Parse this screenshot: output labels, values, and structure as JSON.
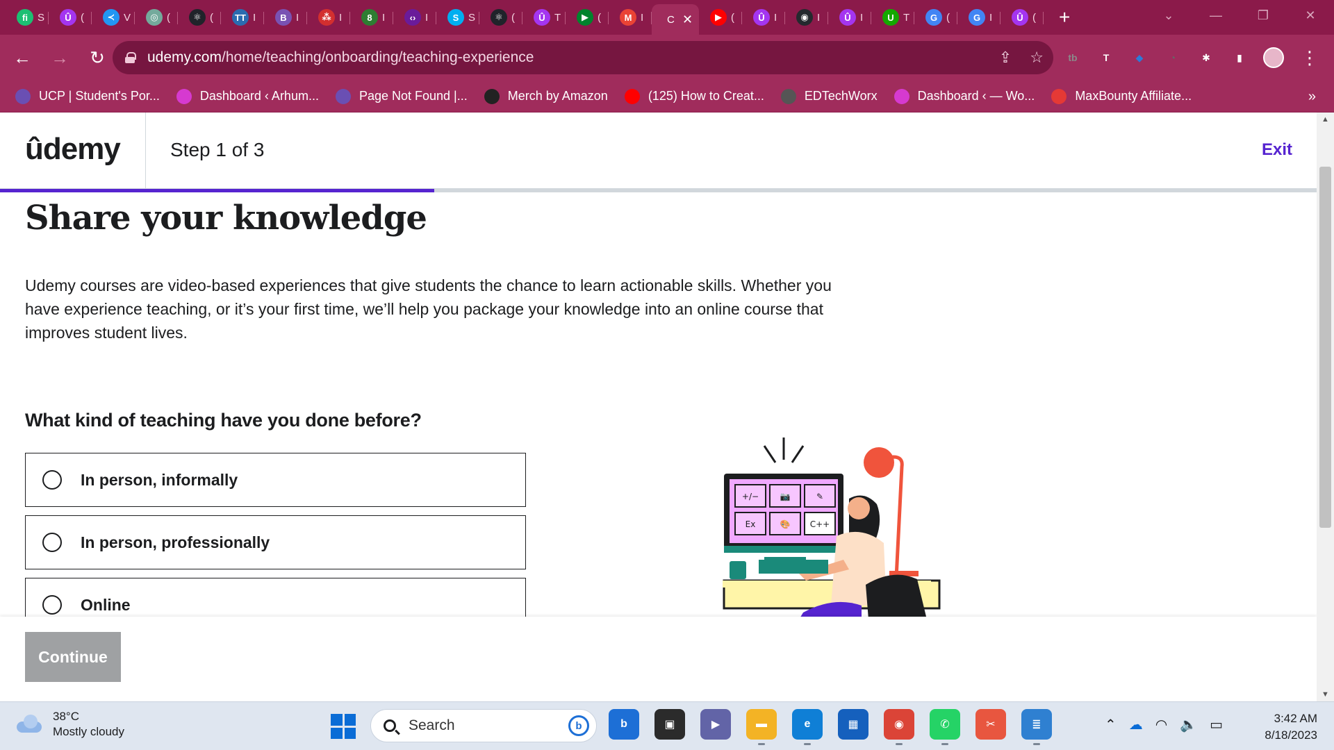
{
  "browser": {
    "tabs": [
      {
        "icon": "fiverr-icon",
        "letter": "fi",
        "color": "#1dbf73",
        "label": "S"
      },
      {
        "icon": "udemy-icon",
        "letter": "Û",
        "color": "#a435f0",
        "label": "("
      },
      {
        "icon": "flutter-icon",
        "letter": "≺",
        "color": "#2196f3",
        "label": "V"
      },
      {
        "icon": "chatgpt-icon",
        "letter": "◎",
        "color": "#74aa9c",
        "label": "("
      },
      {
        "icon": "react-icon",
        "letter": "⚛",
        "color": "#20232a",
        "label": "("
      },
      {
        "icon": "tt-icon",
        "letter": "TT",
        "color": "#2b6cb0",
        "label": "I"
      },
      {
        "icon": "bootstrap-icon",
        "letter": "B",
        "color": "#7952b3",
        "label": "I"
      },
      {
        "icon": "slides-icon",
        "letter": "⁂",
        "color": "#d32f2f",
        "label": "I"
      },
      {
        "icon": "eight-icon",
        "letter": "8",
        "color": "#2e7d32",
        "label": "I"
      },
      {
        "icon": "code-icon",
        "letter": "‹›",
        "color": "#6a1b9a",
        "label": "I"
      },
      {
        "icon": "skype-icon",
        "letter": "S",
        "color": "#00aff0",
        "label": "S"
      },
      {
        "icon": "react-icon",
        "letter": "⚛",
        "color": "#20232a",
        "label": "("
      },
      {
        "icon": "udemy-icon",
        "letter": "Û",
        "color": "#a435f0",
        "label": "T"
      },
      {
        "icon": "meet-icon",
        "letter": "▶",
        "color": "#00832d",
        "label": "("
      },
      {
        "icon": "gmail-icon",
        "letter": "M",
        "color": "#ea4335",
        "label": "I"
      },
      {
        "icon": "youtube-icon",
        "letter": "▶",
        "color": "#ff0000",
        "label": "("
      },
      {
        "icon": "udemy-icon",
        "letter": "Û",
        "color": "#a435f0",
        "label": "I"
      },
      {
        "icon": "github-icon",
        "letter": "◉",
        "color": "#24292e",
        "label": "I"
      },
      {
        "icon": "udemy-icon",
        "letter": "Û",
        "color": "#a435f0",
        "label": "I"
      },
      {
        "icon": "upwork-icon",
        "letter": "U",
        "color": "#14a800",
        "label": "T"
      },
      {
        "icon": "google-icon",
        "letter": "G",
        "color": "#4285f4",
        "label": "("
      },
      {
        "icon": "google-icon",
        "letter": "G",
        "color": "#4285f4",
        "label": "I"
      },
      {
        "icon": "udemy-icon",
        "letter": "Û",
        "color": "#a435f0",
        "label": "("
      }
    ],
    "active_tab": {
      "label": "C"
    },
    "url_host": "udemy.com",
    "url_path": "/home/teaching/onboarding/teaching-experience",
    "extensions": [
      {
        "icon": "tb-extension-icon",
        "letter": "tb",
        "color": "#8a8a8a"
      },
      {
        "icon": "t-extension-icon",
        "letter": "T",
        "color": "#ffffff"
      },
      {
        "icon": "diamond-extension-icon",
        "letter": "◆",
        "color": "#2b7bd8"
      },
      {
        "icon": "pie-extension-icon",
        "letter": "◔",
        "color": "#666666"
      },
      {
        "icon": "puzzle-extensions-icon",
        "letter": "✱",
        "color": "#ffffff"
      },
      {
        "icon": "side-panel-icon",
        "letter": "▮",
        "color": "#ffffff"
      }
    ],
    "bookmarks": [
      {
        "icon": "ucp-icon",
        "label": "UCP | Student's Por...",
        "color": "#6a4fb3"
      },
      {
        "icon": "wordpress-icon",
        "label": "Dashboard ‹ Arhum...",
        "color": "#d63ad0"
      },
      {
        "icon": "ucp-icon",
        "label": "Page Not Found |...",
        "color": "#6a4fb3"
      },
      {
        "icon": "amazon-icon",
        "label": "Merch by Amazon",
        "color": "#222222"
      },
      {
        "icon": "youtube-icon",
        "label": "(125) How to Creat...",
        "color": "#ff0000"
      },
      {
        "icon": "edtech-icon",
        "label": "EDTechWorx",
        "color": "#555555"
      },
      {
        "icon": "wordpress-icon",
        "label": "Dashboard ‹ — Wo...",
        "color": "#d63ad0"
      },
      {
        "icon": "maxbounty-icon",
        "label": "MaxBounty Affiliate...",
        "color": "#e53935"
      }
    ],
    "bookmarks_more": "»"
  },
  "header": {
    "logo": "ûdemy",
    "step": "Step 1 of 3",
    "exit": "Exit",
    "progress": 0.33
  },
  "main": {
    "title": "Share your knowledge",
    "intro": "Udemy courses are video-based experiences that give students the chance to learn actionable skills. Whether you have experience teaching, or it’s your first time, we’ll help you package your knowledge into an online course that improves student lives.",
    "question": "What kind of teaching have you done before?",
    "options": [
      {
        "label": "In person, informally"
      },
      {
        "label": "In person, professionally"
      },
      {
        "label": "Online"
      }
    ]
  },
  "illustration": {
    "screen_tiles": [
      "+/−",
      "📷",
      "✎",
      "Ex",
      "🎨",
      "C++"
    ]
  },
  "footer": {
    "continue": "Continue"
  },
  "taskbar": {
    "temperature": "38°C",
    "weather": "Mostly cloudy",
    "search": "Search",
    "time": "3:42 AM",
    "date": "8/18/2023",
    "apps": [
      {
        "icon": "bing-chat-icon",
        "letter": "b",
        "color": "#1d6fd6",
        "state": ""
      },
      {
        "icon": "task-view-icon",
        "letter": "▣",
        "color": "#2b2b2b",
        "state": ""
      },
      {
        "icon": "teams-icon",
        "letter": "▶",
        "color": "#6264a7",
        "state": ""
      },
      {
        "icon": "file-explorer-icon",
        "letter": "▬",
        "color": "#f3b325",
        "state": "open"
      },
      {
        "icon": "edge-icon",
        "letter": "e",
        "color": "#0f7fd6",
        "state": "open"
      },
      {
        "icon": "store-icon",
        "letter": "▦",
        "color": "#1560bd",
        "state": ""
      },
      {
        "icon": "chrome-icon",
        "letter": "◉",
        "color": "#db4437",
        "state": "open"
      },
      {
        "icon": "whatsapp-icon",
        "letter": "✆",
        "color": "#25d366",
        "state": "open"
      },
      {
        "icon": "snipping-tool-icon",
        "letter": "✂",
        "color": "#e8563f",
        "state": "active"
      },
      {
        "icon": "notepad-icon",
        "letter": "≣",
        "color": "#2f80d1",
        "state": "open"
      }
    ]
  }
}
